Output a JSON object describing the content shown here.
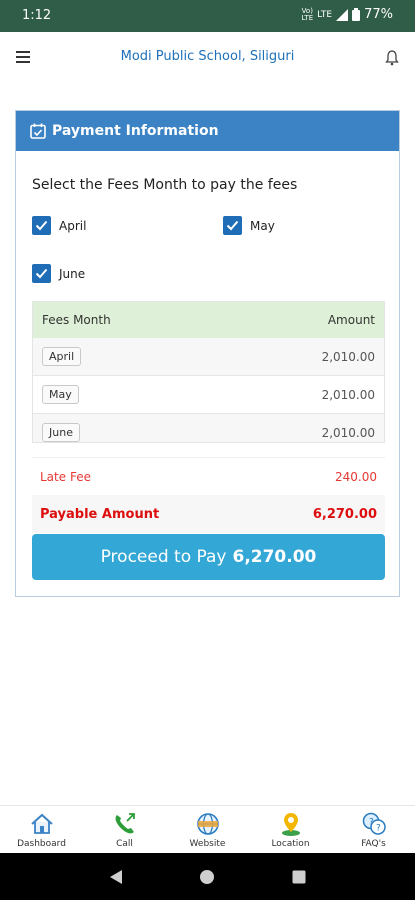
{
  "statusbar": {
    "time": "1:12",
    "volte_top": "Vo)",
    "volte_bottom": "LTE",
    "network": "LTE",
    "battery": "77%"
  },
  "appbar": {
    "title": "Modi Public School, Siliguri"
  },
  "card": {
    "header": "Payment Information",
    "subtitle": "Select the Fees Month to pay the fees",
    "months": [
      {
        "label": "April",
        "checked": true
      },
      {
        "label": "May",
        "checked": true
      },
      {
        "label": "June",
        "checked": true
      }
    ],
    "table": {
      "headers": [
        "Fees Month",
        "Amount"
      ],
      "rows": [
        {
          "month": "April",
          "amount": "2,010.00"
        },
        {
          "month": "May",
          "amount": "2,010.00"
        },
        {
          "month": "June",
          "amount": "2,010.00"
        }
      ]
    },
    "late_fee": {
      "label": "Late Fee",
      "value": "240.00"
    },
    "payable": {
      "label": "Payable Amount",
      "value": "6,270.00"
    },
    "proceed": {
      "label": "Proceed to Pay",
      "amount": "6,270.00"
    }
  },
  "bottom_nav": [
    {
      "label": "Dashboard",
      "icon": "home-icon"
    },
    {
      "label": "Call",
      "icon": "phone-icon"
    },
    {
      "label": "Website",
      "icon": "globe-icon"
    },
    {
      "label": "Location",
      "icon": "location-pin-icon"
    },
    {
      "label": "FAQ's",
      "icon": "faq-icon"
    }
  ],
  "colors": {
    "status": "#2f5d48",
    "header": "#3b83c4",
    "accent": "#1f6db6",
    "button": "#33a7d6",
    "danger": "#dd0e0e"
  }
}
